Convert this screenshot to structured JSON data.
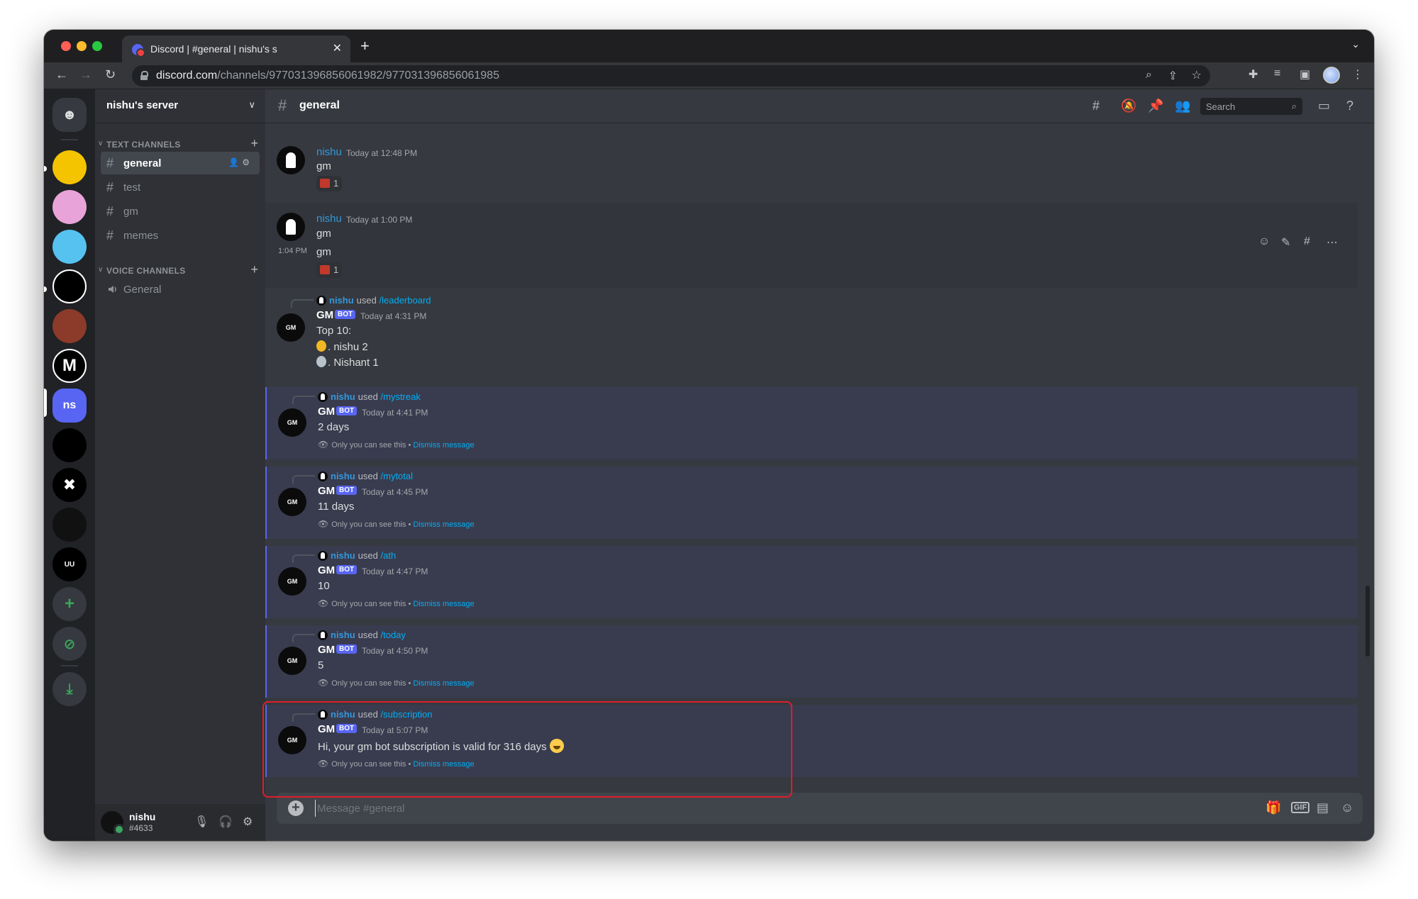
{
  "browser": {
    "tab_title": "Discord | #general | nishu's s",
    "url_domain": "discord.com",
    "url_path": "/channels/977031396856061982/977031396856061985",
    "new_tab": "+",
    "tab_close": "✕",
    "tab_search": "⌄"
  },
  "guilds": [
    {
      "label": "",
      "color": "#f5c400"
    },
    {
      "label": "",
      "color": "#e8a4d8"
    },
    {
      "label": "",
      "color": "#56c2f0"
    },
    {
      "label": "",
      "color": "#000000"
    },
    {
      "label": "",
      "color": "#8c3a2a"
    },
    {
      "label": "M",
      "color": "#000000"
    },
    {
      "label": "ns",
      "color": "#5865f2"
    },
    {
      "label": "",
      "color": "#000000"
    },
    {
      "label": "✖",
      "color": "#000000"
    },
    {
      "label": "",
      "color": "#111111"
    },
    {
      "label": "UU",
      "color": "#000000"
    }
  ],
  "guild_utils": [
    "+",
    "⊘",
    "⤓"
  ],
  "server": {
    "name": "nishu's server"
  },
  "categories": {
    "text": "TEXT CHANNELS",
    "voice": "VOICE CHANNELS"
  },
  "text_channels": [
    "general",
    "test",
    "gm",
    "memes"
  ],
  "voice_channels": [
    "General"
  ],
  "user": {
    "name": "nishu",
    "tag": "#4633"
  },
  "channel": {
    "name": "general",
    "search_placeholder": "Search"
  },
  "messages": {
    "m1": {
      "author": "nishu",
      "time": "Today at 12:48 PM",
      "text": "gm",
      "reaction_count": "1"
    },
    "m2": {
      "author": "nishu",
      "time": "Today at 1:00 PM",
      "text": "gm",
      "hover_time": "1:04 PM",
      "text2": "gm",
      "reaction_count": "1"
    },
    "m3": {
      "reply_user": "nishu",
      "reply_used": "used",
      "reply_cmd": "/leaderboard",
      "author": "GM",
      "bot": "BOT",
      "time": "Today at 4:31 PM",
      "line1": "Top 10:",
      "line2": ". nishu 2",
      "line3": ". Nishant 1"
    },
    "m4": {
      "reply_user": "nishu",
      "reply_used": "used",
      "reply_cmd": "/mystreak",
      "author": "GM",
      "bot": "BOT",
      "time": "Today at 4:41 PM",
      "text": "2 days",
      "note": "Only you can see this •",
      "dismiss": "Dismiss message"
    },
    "m5": {
      "reply_user": "nishu",
      "reply_used": "used",
      "reply_cmd": "/mytotal",
      "author": "GM",
      "bot": "BOT",
      "time": "Today at 4:45 PM",
      "text": "11 days",
      "note": "Only you can see this •",
      "dismiss": "Dismiss message"
    },
    "m6": {
      "reply_user": "nishu",
      "reply_used": "used",
      "reply_cmd": "/ath",
      "author": "GM",
      "bot": "BOT",
      "time": "Today at 4:47 PM",
      "text": "10",
      "note": "Only you can see this •",
      "dismiss": "Dismiss message"
    },
    "m7": {
      "reply_user": "nishu",
      "reply_used": "used",
      "reply_cmd": "/today",
      "author": "GM",
      "bot": "BOT",
      "time": "Today at 4:50 PM",
      "text": "5",
      "note": "Only you can see this •",
      "dismiss": "Dismiss message"
    },
    "m8": {
      "reply_user": "nishu",
      "reply_used": "used",
      "reply_cmd": "/subscription",
      "author": "GM",
      "bot": "BOT",
      "time": "Today at 5:07 PM",
      "text": "Hi, your gm bot subscription is valid for 316 days",
      "note": "Only you can see this •",
      "dismiss": "Dismiss message"
    }
  },
  "avatar_label": "GM",
  "composer": {
    "placeholder": "Message #general",
    "gif": "GIF"
  },
  "colors": {
    "blurple": "#5865f2",
    "highlight": "#e11d2a",
    "online": "#3ba55d"
  }
}
